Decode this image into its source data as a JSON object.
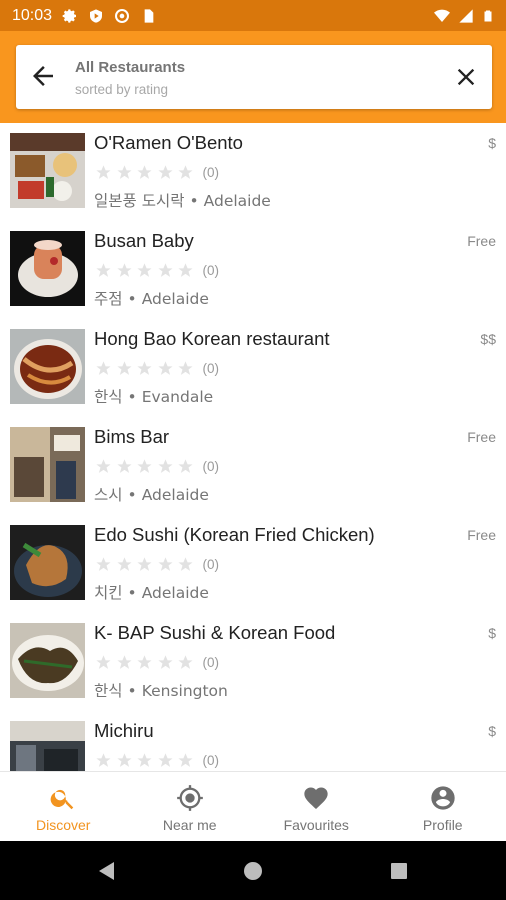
{
  "status_bar": {
    "time": "10:03",
    "left_icons": [
      "gear-icon",
      "play-shield-icon",
      "at-sign-icon",
      "sim-card-icon"
    ],
    "right_icons": [
      "wifi-icon",
      "signal-icon",
      "battery-icon"
    ]
  },
  "search": {
    "title": "All Restaurants",
    "subtitle": "sorted by rating"
  },
  "restaurants": [
    {
      "name": "O'Ramen O'Bento",
      "price": "$",
      "rating_count": "(0)",
      "category": "일본풍 도시락",
      "location": "Adelaide"
    },
    {
      "name": "Busan Baby",
      "price": "Free",
      "rating_count": "(0)",
      "category": "주점",
      "location": "Adelaide"
    },
    {
      "name": "Hong Bao Korean restaurant",
      "price": "$$",
      "rating_count": "(0)",
      "category": "한식",
      "location": "Evandale"
    },
    {
      "name": "Bims Bar",
      "price": "Free",
      "rating_count": "(0)",
      "category": "스시",
      "location": "Adelaide"
    },
    {
      "name": "Edo Sushi (Korean Fried Chicken)",
      "price": "Free",
      "rating_count": "(0)",
      "category": "치킨",
      "location": "Adelaide"
    },
    {
      "name": "K- BAP Sushi & Korean Food",
      "price": "$",
      "rating_count": "(0)",
      "category": "한식",
      "location": "Kensington"
    },
    {
      "name": "Michiru",
      "price": "$",
      "rating_count": "(0)",
      "category": "",
      "location": ""
    }
  ],
  "separator": "•",
  "nav": {
    "discover": "Discover",
    "near_me": "Near me",
    "favourites": "Favourites",
    "profile": "Profile"
  },
  "colors": {
    "status_bar": "#d9770c",
    "accent": "#f9961e",
    "active_tab": "#f29420"
  }
}
